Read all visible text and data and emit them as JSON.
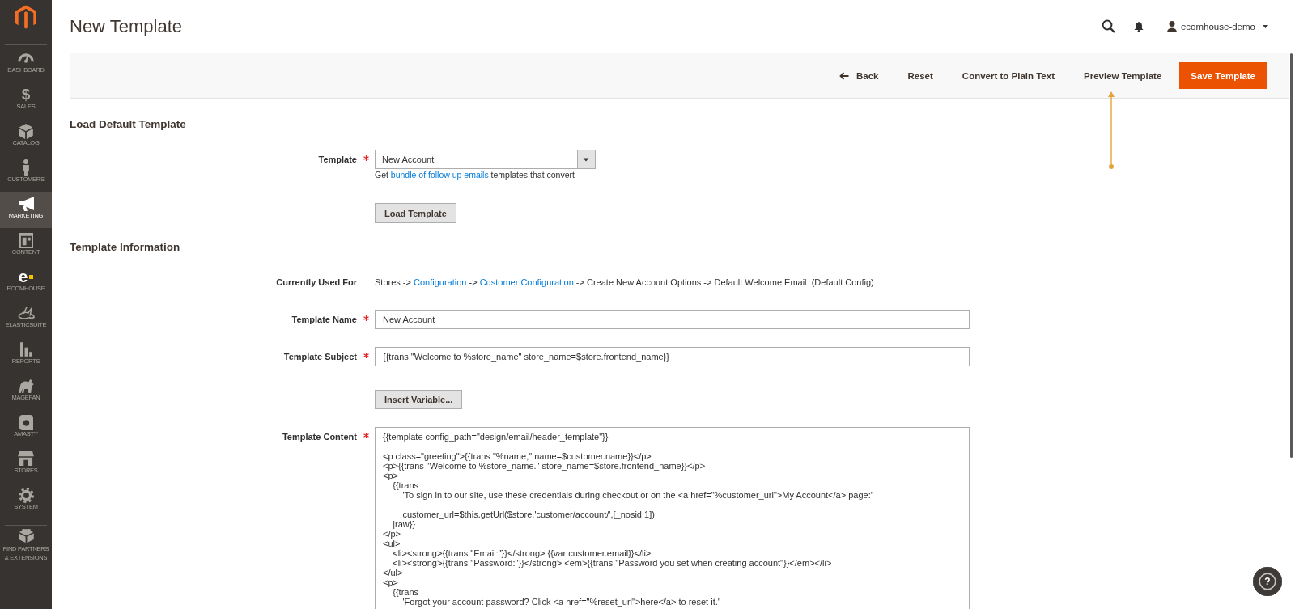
{
  "sidebar": {
    "items": [
      {
        "label": "DASHBOARD",
        "selected": false
      },
      {
        "label": "SALES",
        "glyph": "$",
        "selected": false
      },
      {
        "label": "CATALOG",
        "selected": false
      },
      {
        "label": "CUSTOMERS",
        "selected": false
      },
      {
        "label": "MARKETING",
        "selected": true
      },
      {
        "label": "CONTENT",
        "selected": false
      },
      {
        "label": "ECOMHOUSE",
        "glyph": "e",
        "selected": false
      },
      {
        "label": "ELASTICSUITE",
        "selected": false
      },
      {
        "label": "REPORTS",
        "selected": false
      },
      {
        "label": "MAGEFAN",
        "selected": false
      },
      {
        "label": "AMASTY",
        "selected": false
      },
      {
        "label": "STORES",
        "selected": false
      },
      {
        "label": "SYSTEM",
        "selected": false
      },
      {
        "label": "FIND PARTNERS & EXTENSIONS",
        "selected": false
      }
    ]
  },
  "header": {
    "title": "New Template",
    "user": "ecomhouse-demo"
  },
  "toolbar": {
    "buttons": [
      {
        "kind": "back",
        "label": "Back"
      },
      {
        "kind": "plain",
        "label": "Reset"
      },
      {
        "kind": "plain",
        "label": "Convert to Plain Text"
      },
      {
        "kind": "plain",
        "label": "Preview Template"
      },
      {
        "kind": "primary",
        "label": "Save Template"
      }
    ]
  },
  "load_default_template": {
    "heading": "Load Default Template",
    "template_field": {
      "label": "Template",
      "required": true,
      "value": "New Account",
      "hint": [
        {
          "kind": "text",
          "text": "Get "
        },
        {
          "kind": "link",
          "text": "bundle of follow up emails"
        },
        {
          "kind": "text",
          "text": " templates that convert"
        }
      ]
    },
    "load_button": "Load Template"
  },
  "template_information": {
    "heading": "Template Information",
    "currently_used_for": {
      "label": "Currently Used For",
      "segments": [
        {
          "kind": "text",
          "text": "Stores -> "
        },
        {
          "kind": "link",
          "text": "Configuration"
        },
        {
          "kind": "text",
          "text": " -> "
        },
        {
          "kind": "link",
          "text": "Customer Configuration"
        },
        {
          "kind": "text",
          "text": " -> Create New Account Options -> Default Welcome Email  (Default Config)"
        }
      ]
    },
    "fields": [
      {
        "kind": "input",
        "label": "Template Name",
        "required": true,
        "value": "New Account"
      },
      {
        "kind": "input",
        "label": "Template Subject",
        "required": true,
        "value": "{{trans \"Welcome to %store_name\" store_name=$store.frontend_name}}"
      },
      {
        "kind": "button",
        "label": "Insert Variable..."
      },
      {
        "kind": "textarea",
        "label": "Template Content",
        "required": true,
        "value": "{{template config_path=\"design/email/header_template\"}}\n\n<p class=\"greeting\">{{trans \"%name,\" name=$customer.name}}</p>\n<p>{{trans \"Welcome to %store_name.\" store_name=$store.frontend_name}}</p>\n<p>\n    {{trans\n        'To sign in to our site, use these credentials during checkout or on the <a href=\"%customer_url\">My Account</a> page:'\n\n        customer_url=$this.getUrl($store,'customer/account/',[_nosid:1])\n    |raw}}\n</p>\n<ul>\n    <li><strong>{{trans \"Email:\"}}</strong> {{var customer.email}}</li>\n    <li><strong>{{trans \"Password:\"}}</strong> <em>{{trans \"Password you set when creating account\"}}</em></li>\n</ul>\n<p>\n    {{trans\n        'Forgot your account password? Click <a href=\"%reset_url\">here</a> to reset it.'"
      }
    ]
  },
  "help_button": {
    "label": "?"
  }
}
